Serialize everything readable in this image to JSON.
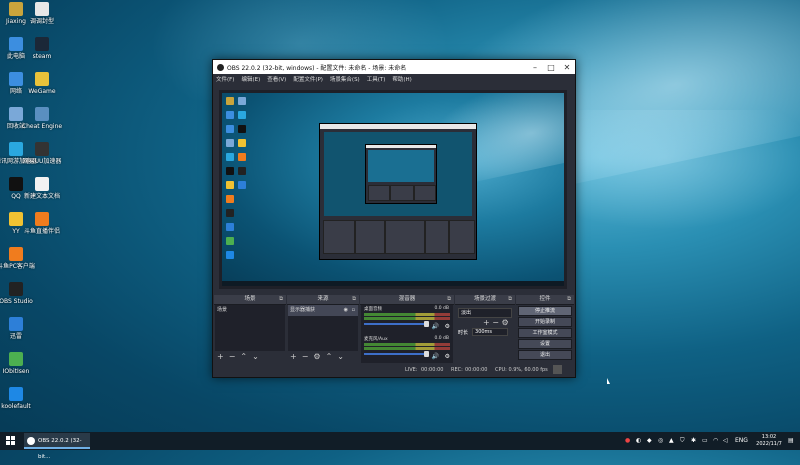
{
  "desktop": {
    "icons": [
      {
        "label": "Jiaxing",
        "color": "#c9a43c"
      },
      {
        "label": "调调封型",
        "color": "#e8e8e8"
      },
      {
        "label": "此电脑",
        "color": "#3c8ee0"
      },
      {
        "label": "steam",
        "color": "#1b2838"
      },
      {
        "label": "网络",
        "color": "#3c8ee0"
      },
      {
        "label": "WeGame",
        "color": "#e8c23a"
      },
      {
        "label": "回收站",
        "color": "#7aa8d8"
      },
      {
        "label": "Cheat Engine",
        "color": "#5a8fc0"
      },
      {
        "label": "腾讯网游加速器",
        "color": "#2aa8e0"
      },
      {
        "label": "网易UU加速器",
        "color": "#333"
      },
      {
        "label": "QQ",
        "color": "#111"
      },
      {
        "label": "新建文本文档",
        "color": "#f2f2f2"
      },
      {
        "label": "YY",
        "color": "#f1c232"
      },
      {
        "label": "斗鱼直播伴侣",
        "color": "#f07c1e"
      },
      {
        "label": "斗鱼PC客户端",
        "color": "#f07c1e"
      },
      {
        "label": "OBS Studio",
        "color": "#222"
      },
      {
        "label": "迅雷",
        "color": "#2d7fd8"
      },
      {
        "label": "IObitIsen",
        "color": "#4caf50"
      },
      {
        "label": "koolefault",
        "color": "#1e88e5"
      }
    ]
  },
  "obs": {
    "title": "OBS 22.0.2 (32-bit, windows) - 配置文件: 未命名 - 场景: 未命名",
    "menu": [
      "文件(F)",
      "编辑(E)",
      "查看(V)",
      "配置文件(P)",
      "场景集合(S)",
      "工具(T)",
      "帮助(H)"
    ],
    "docks": {
      "scenes": {
        "title": "场景",
        "items": [
          "场景"
        ]
      },
      "sources": {
        "title": "来源",
        "items": [
          "显示器捕获"
        ]
      },
      "mixer": {
        "title": "混音器",
        "channels": [
          {
            "name": "桌面音频",
            "db": "0.0 dB"
          },
          {
            "name": "麦克风/Aux",
            "db": "0.0 dB"
          }
        ]
      },
      "transitions": {
        "title": "场景过渡",
        "type": "淡出",
        "duration_label": "时长",
        "duration": "300ms"
      },
      "controls": {
        "title": "控件",
        "buttons": [
          "停止推流",
          "开始录制",
          "工作室模式",
          "设置",
          "退出"
        ]
      }
    },
    "status": {
      "live_label": "LIVE:",
      "live_time": "00:00:00",
      "rec_label": "REC:",
      "rec_time": "00:00:00",
      "cpu": "CPU: 0.9%, 60.00 fps"
    }
  },
  "taskbar": {
    "app_label": "OBS 22.0.2 (32-bit...",
    "lang": "ENG",
    "time": "13:02",
    "date": "2022/11/7"
  }
}
